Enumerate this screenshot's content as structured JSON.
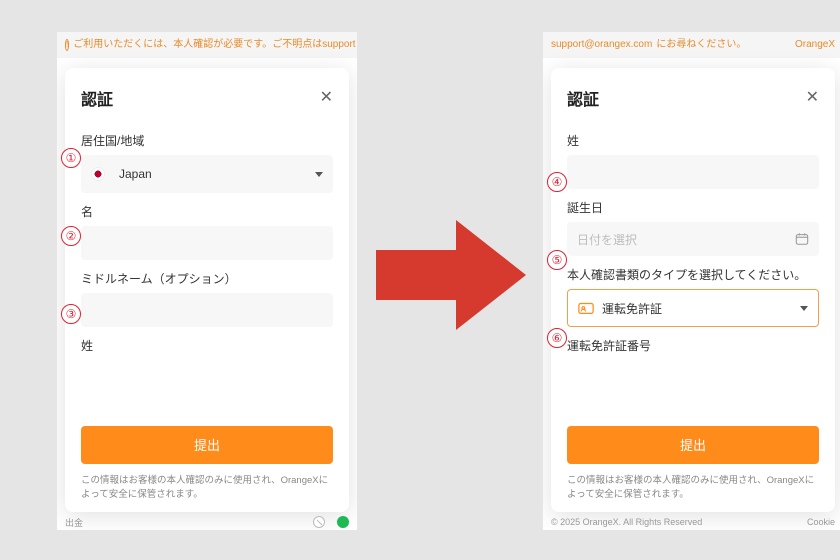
{
  "left": {
    "banner": "ご利用いただくには、本人確認が必要です。ご不明点はsupport",
    "title": "認証",
    "country_label": "居住国/地域",
    "country_value": "Japan",
    "name_label": "名",
    "middle_label": "ミドルネーム（オプション）",
    "lastname_label": "姓",
    "submit": "提出",
    "disclaimer": "この情報はお客様の本人確認のみに使用され、OrangeXによって安全に保管されます。",
    "footer_left": "出金"
  },
  "right": {
    "banner_email": "support@orangex.com",
    "banner_tail": "にお尋ねください。",
    "brand": "OrangeX",
    "title": "認証",
    "lastname_label": "姓",
    "dob_label": "誕生日",
    "dob_placeholder": "日付を選択",
    "doctype_label": "本人確認書類のタイプを選択してください。",
    "doctype_value": "運転免許証",
    "docnum_label": "運転免許証番号",
    "submit": "提出",
    "disclaimer": "この情報はお客様の本人確認のみに使用され、OrangeXによって安全に保管されます。",
    "footer_copy": "© 2025 OrangeX. All Rights Reserved",
    "footer_cookie": "Cookie"
  },
  "annot": {
    "a1": "①",
    "a2": "②",
    "a3": "③",
    "a4": "④",
    "a5": "⑤",
    "a6": "⑥"
  }
}
